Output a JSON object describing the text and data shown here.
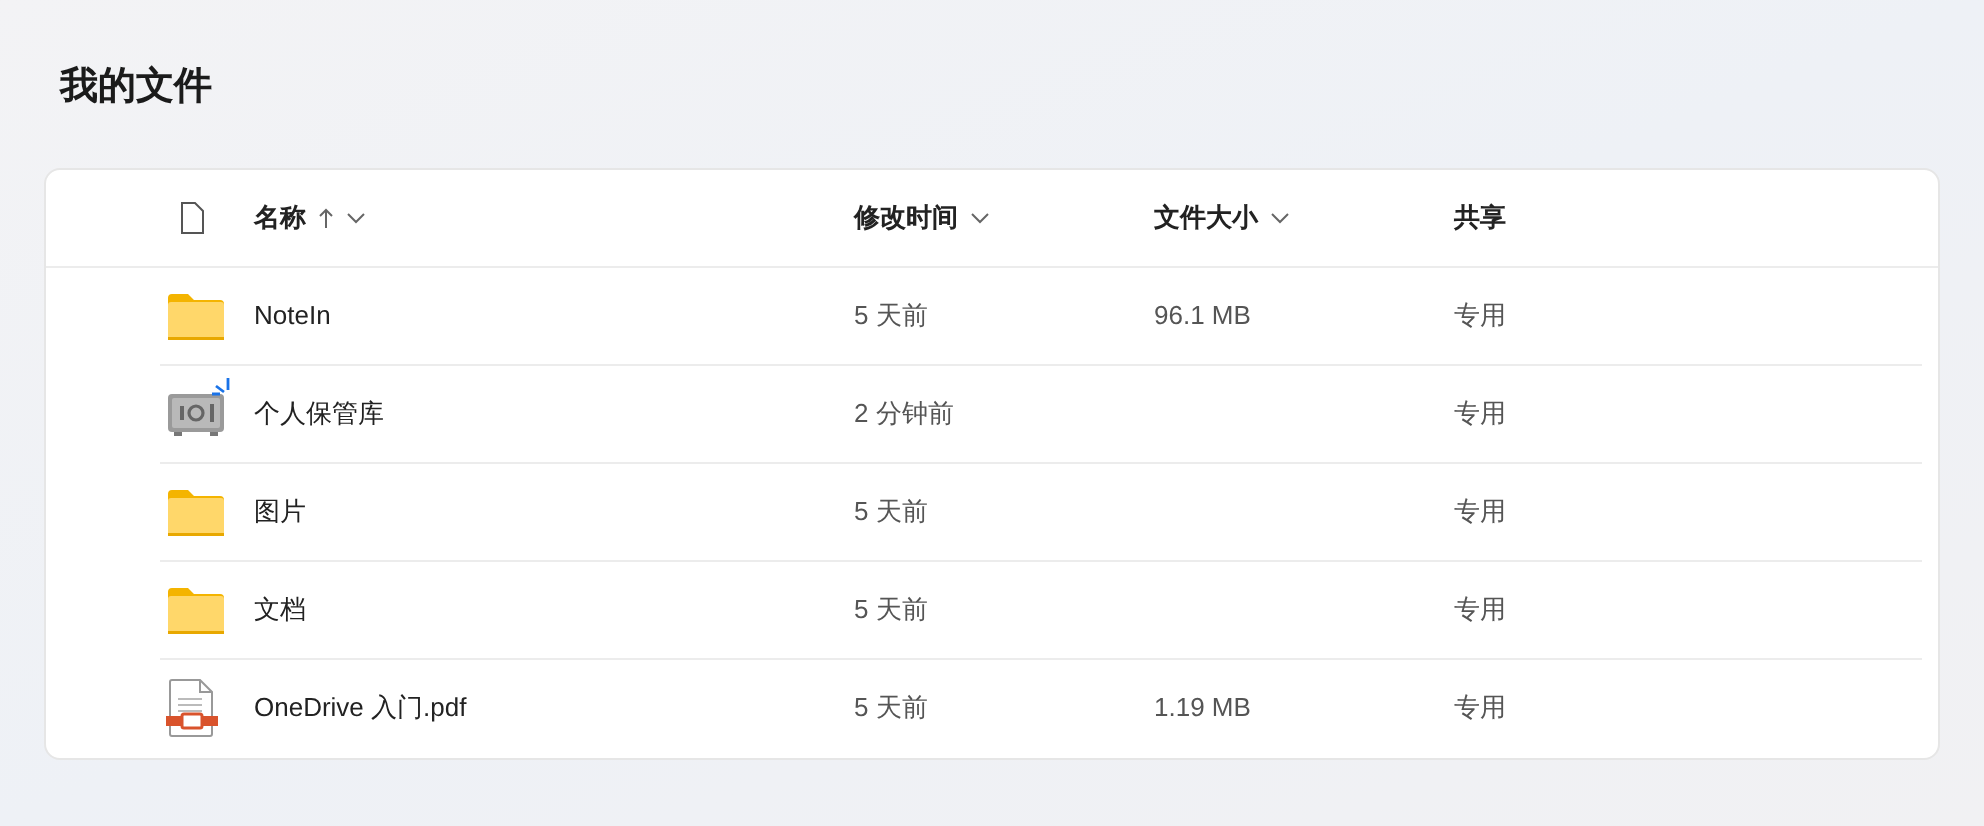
{
  "title": "我的文件",
  "columns": [
    {
      "label": "名称",
      "sort_ascending": true,
      "has_menu": true
    },
    {
      "label": "修改时间",
      "sort_ascending": false,
      "has_menu": true
    },
    {
      "label": "文件大小",
      "sort_ascending": false,
      "has_menu": true
    },
    {
      "label": "共享",
      "sort_ascending": false,
      "has_menu": false
    }
  ],
  "rows": [
    {
      "kind": "folder",
      "name": "NoteIn",
      "modified": "5 天前",
      "size": "96.1 MB",
      "sharing": "专用",
      "syncing": false
    },
    {
      "kind": "vault",
      "name": "个人保管库",
      "modified": "2 分钟前",
      "sharing": "专用",
      "syncing": true
    },
    {
      "kind": "folder",
      "name": "图片",
      "modified": "5 天前",
      "sharing": "专用",
      "syncing": false
    },
    {
      "kind": "folder",
      "name": "文档",
      "modified": "5 天前",
      "sharing": "专用",
      "syncing": false
    },
    {
      "kind": "pdf",
      "name": "OneDrive 入门.pdf",
      "modified": "5 天前",
      "size": "1.19 MB",
      "sharing": "专用",
      "syncing": false
    }
  ]
}
